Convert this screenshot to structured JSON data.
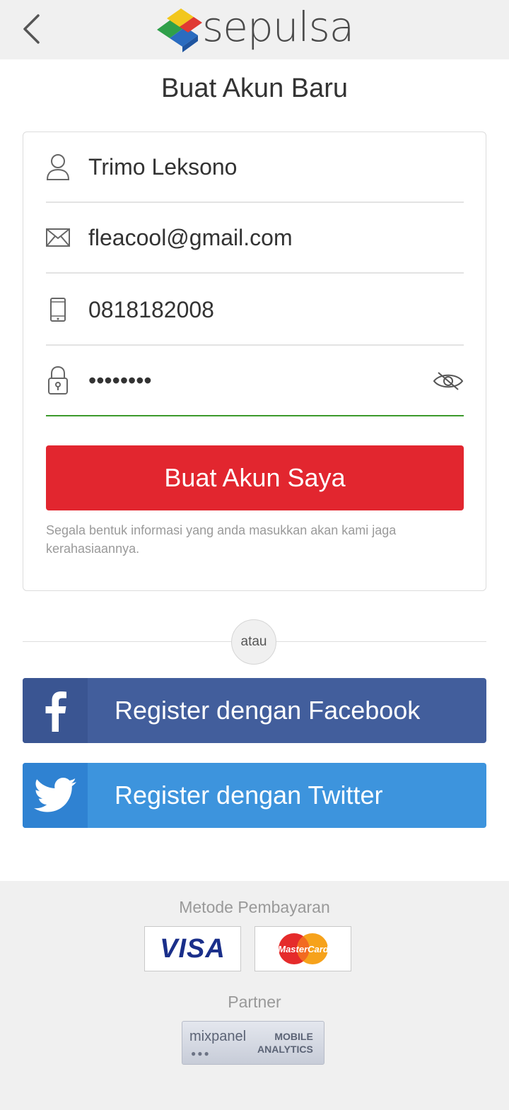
{
  "header": {
    "brand": "sepulsa",
    "back_icon": "chevron-left-icon"
  },
  "page": {
    "title": "Buat Akun Baru"
  },
  "form": {
    "name_value": "Trimo Leksono",
    "email_value": "fleacool@gmail.com",
    "phone_value": "0818182008",
    "password_value": "********",
    "submit_label": "Buat Akun Saya",
    "privacy_note": "Segala bentuk informasi yang anda masukkan akan kami jaga kerahasiaannya."
  },
  "separator": {
    "label": "atau"
  },
  "social": {
    "facebook_label": "Register dengan Facebook",
    "twitter_label": "Register dengan Twitter"
  },
  "footer": {
    "payment_label": "Metode Pembayaran",
    "visa_label": "VISA",
    "mastercard_label": "MasterCard",
    "partner_label": "Partner",
    "partner_name": "mixpanel",
    "partner_sub_1": "MOBILE",
    "partner_sub_2": "ANALYTICS"
  },
  "colors": {
    "primary_red": "#e2262f",
    "facebook": "#425e9c",
    "twitter": "#3d94dd",
    "active_underline": "#3c9a2c"
  }
}
